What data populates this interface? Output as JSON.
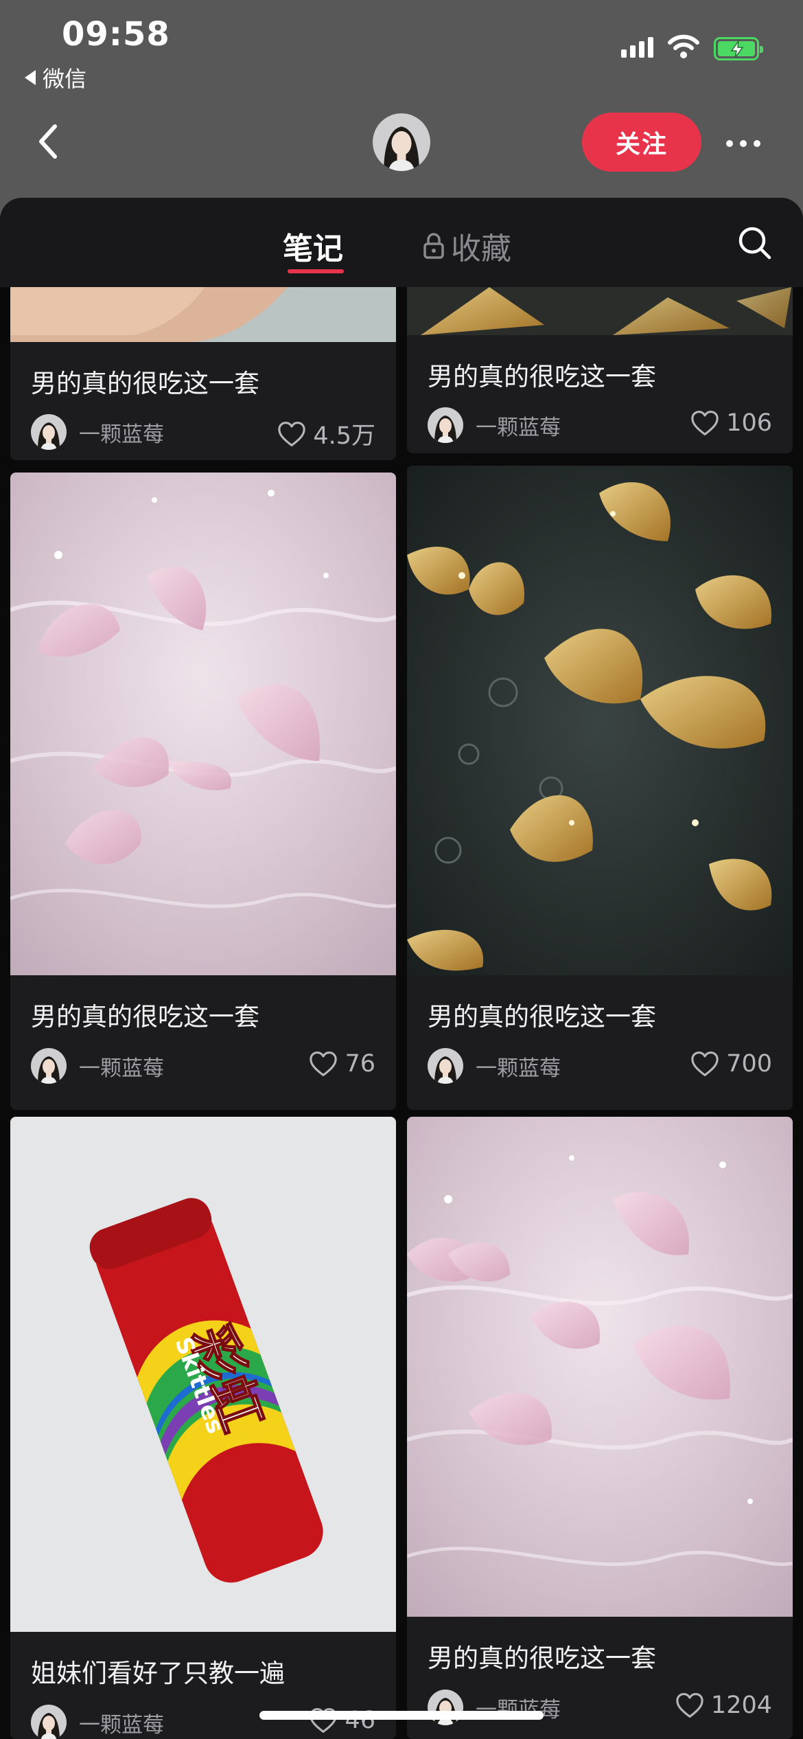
{
  "status_bar": {
    "time": "09:58",
    "back_app": "微信"
  },
  "nav": {
    "follow_label": "关注"
  },
  "tabs": {
    "notes": "笔记",
    "favorites": "收藏"
  },
  "colors": {
    "accent": "#e8344a",
    "battery": "#4bd964",
    "card_bg": "#1c1c1f"
  },
  "cards": [
    {
      "title": "男的真的很吃这一套",
      "author": "一颗蓝莓",
      "likes": "4.5万"
    },
    {
      "title": "男的真的很吃这一套",
      "author": "一颗蓝莓",
      "likes": "106"
    },
    {
      "title": "男的真的很吃这一套",
      "author": "一颗蓝莓",
      "likes": "76"
    },
    {
      "title": "男的真的很吃这一套",
      "author": "一颗蓝莓",
      "likes": "700"
    },
    {
      "title": "姐妹们看好了只教一遍",
      "author": "一颗蓝莓",
      "likes": "46",
      "product_text": [
        "彩虹",
        "Skittles"
      ]
    },
    {
      "title": "男的真的很吃这一套",
      "author": "一颗蓝莓",
      "likes": "1204"
    }
  ],
  "icons": [
    "back-icon",
    "lock-icon",
    "search-icon",
    "heart-icon",
    "more-icon",
    "wifi-icon",
    "battery-icon",
    "signal-icon"
  ]
}
